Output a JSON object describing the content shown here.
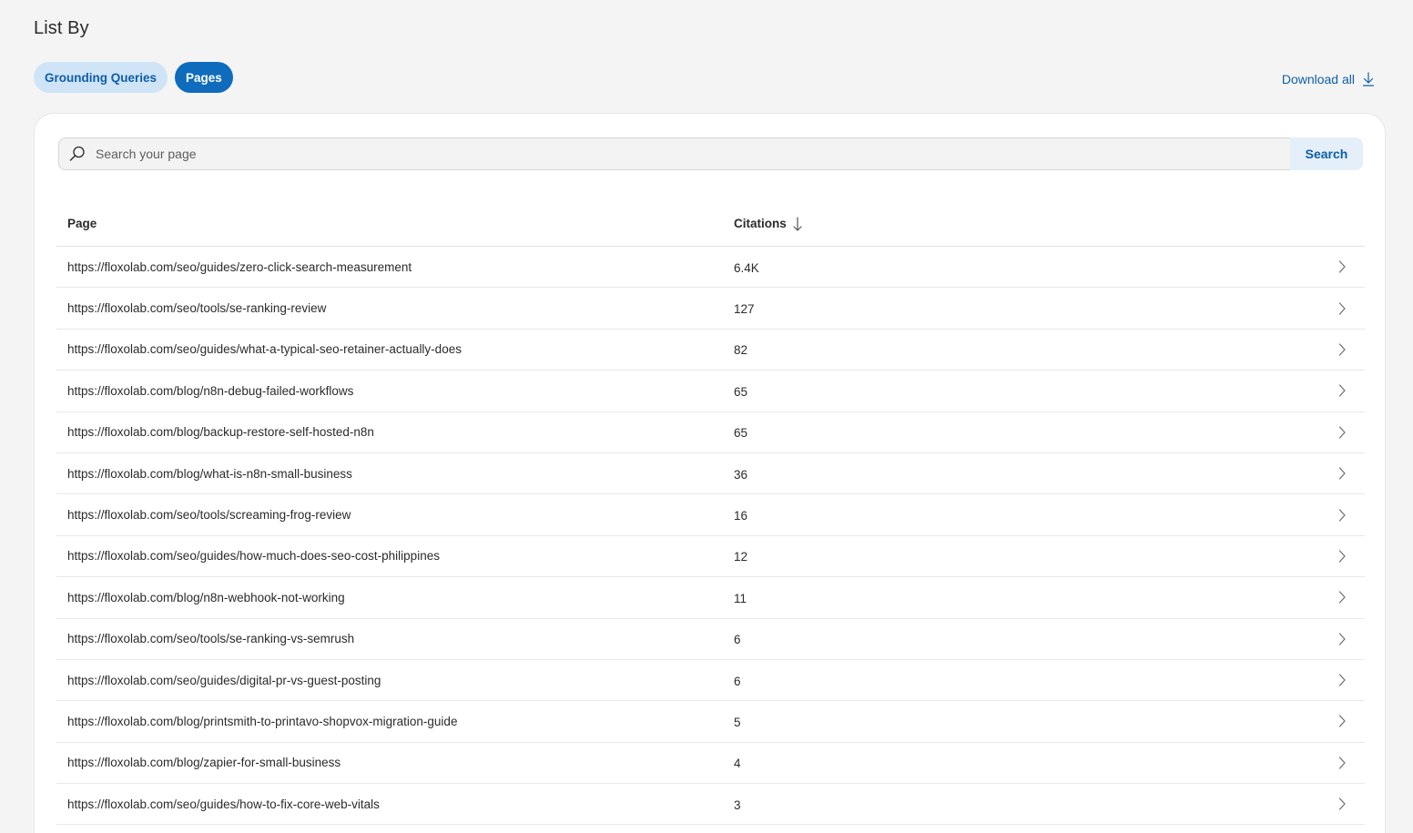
{
  "header": {
    "title": "List By"
  },
  "tabs": [
    {
      "label": "Grounding Queries",
      "active": false
    },
    {
      "label": "Pages",
      "active": true
    }
  ],
  "download_all": {
    "label": "Download all",
    "icon": "download-icon"
  },
  "search": {
    "placeholder": "Search your page",
    "value": "",
    "button_label": "Search",
    "icon": "search-icon"
  },
  "table": {
    "columns": {
      "page": "Page",
      "citations": "Citations",
      "sort_icon": "arrow-down-icon"
    },
    "rows": [
      {
        "page": "https://floxolab.com/seo/guides/zero-click-search-measurement",
        "citations": "6.4K"
      },
      {
        "page": "https://floxolab.com/seo/tools/se-ranking-review",
        "citations": "127"
      },
      {
        "page": "https://floxolab.com/seo/guides/what-a-typical-seo-retainer-actually-does",
        "citations": "82"
      },
      {
        "page": "https://floxolab.com/blog/n8n-debug-failed-workflows",
        "citations": "65"
      },
      {
        "page": "https://floxolab.com/blog/backup-restore-self-hosted-n8n",
        "citations": "65"
      },
      {
        "page": "https://floxolab.com/blog/what-is-n8n-small-business",
        "citations": "36"
      },
      {
        "page": "https://floxolab.com/seo/tools/screaming-frog-review",
        "citations": "16"
      },
      {
        "page": "https://floxolab.com/seo/guides/how-much-does-seo-cost-philippines",
        "citations": "12"
      },
      {
        "page": "https://floxolab.com/blog/n8n-webhook-not-working",
        "citations": "11"
      },
      {
        "page": "https://floxolab.com/seo/tools/se-ranking-vs-semrush",
        "citations": "6"
      },
      {
        "page": "https://floxolab.com/seo/guides/digital-pr-vs-guest-posting",
        "citations": "6"
      },
      {
        "page": "https://floxolab.com/blog/printsmith-to-printavo-shopvox-migration-guide",
        "citations": "5"
      },
      {
        "page": "https://floxolab.com/blog/zapier-for-small-business",
        "citations": "4"
      },
      {
        "page": "https://floxolab.com/seo/guides/how-to-fix-core-web-vitals",
        "citations": "3"
      }
    ]
  },
  "colors": {
    "accent": "#0f6cbd",
    "accent_text": "#0f5ea8",
    "tab_inactive_bg": "#cfe4f7",
    "page_bg": "#f4f4f4"
  }
}
